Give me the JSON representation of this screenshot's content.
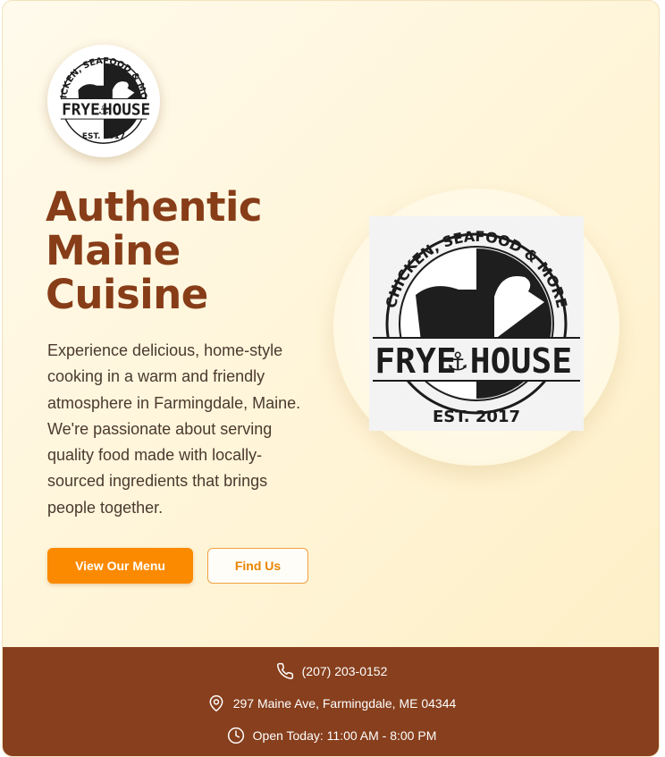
{
  "brand": {
    "logo_text_top": "CHICKEN, SEAFOOD & MORE",
    "logo_text_name_left": "FRYE",
    "logo_text_name_right": "HOUSE",
    "logo_text_est": "EST. 2017"
  },
  "hero": {
    "headline_line1": "Authentic",
    "headline_line2": "Maine",
    "headline_line3": "Cuisine",
    "description": "Experience delicious, home-style cooking in a warm and friendly atmosphere in Farmingdale, Maine. We're passionate about serving quality food made with locally-sourced ingredients that brings people together."
  },
  "buttons": {
    "menu_label": "View Our Menu",
    "find_label": "Find Us"
  },
  "footer": {
    "phone": "(207) 203-0152",
    "address": "297 Maine Ave, Farmingdale, ME 04344",
    "hours": "Open Today: 11:00 AM - 8:00 PM"
  },
  "icons": {
    "phone": "phone-icon",
    "location": "location-pin-icon",
    "clock": "clock-icon",
    "anchor": "anchor-icon"
  },
  "colors": {
    "headline": "#873d18",
    "primary_button": "#fb8a00",
    "footer_bg": "#873f1d",
    "background": "#fff4d6"
  }
}
